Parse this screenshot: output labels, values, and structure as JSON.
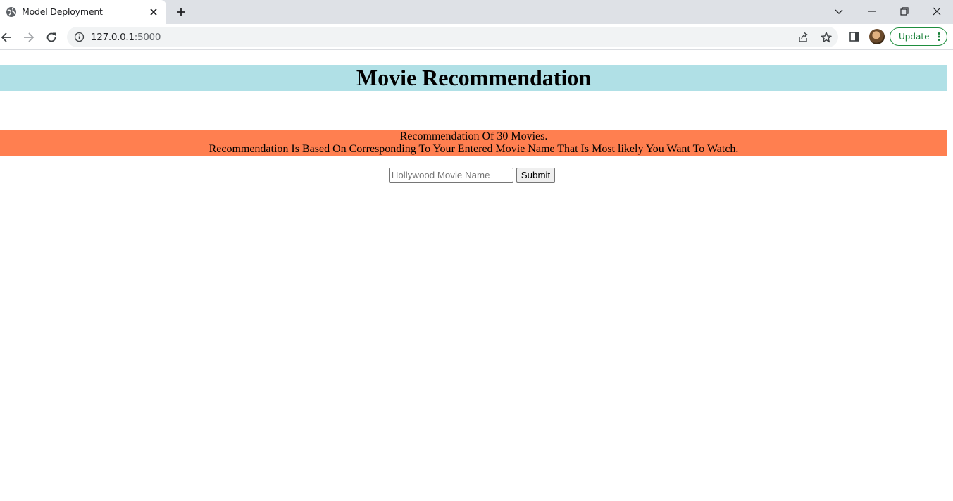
{
  "browser": {
    "tab_title": "Model Deployment",
    "url_host": "127.0.0.1",
    "url_port": ":5000",
    "update_label": "Update"
  },
  "page": {
    "title": "Movie Recommendation",
    "info_line1": "Recommendation Of 30 Movies.",
    "info_line2": "Recommendation Is Based On Corresponding To Your Entered Movie Name That Is Most likely You Want To Watch.",
    "input_placeholder": "Hollywood Movie Name",
    "input_value": "",
    "submit_label": "Submit"
  },
  "colors": {
    "banner_bg": "#b0e0e6",
    "info_bg": "#ff7f50",
    "update_green": "#188038"
  },
  "icons": {
    "favicon": "globe-icon",
    "tab_close": "close-icon",
    "new_tab": "plus-icon",
    "back": "back-arrow-icon",
    "forward": "forward-arrow-icon",
    "reload": "reload-icon",
    "site_info": "info-icon",
    "share": "share-icon",
    "bookmark": "star-icon",
    "side_panel": "side-panel-icon",
    "menu": "kebab-menu-icon"
  }
}
